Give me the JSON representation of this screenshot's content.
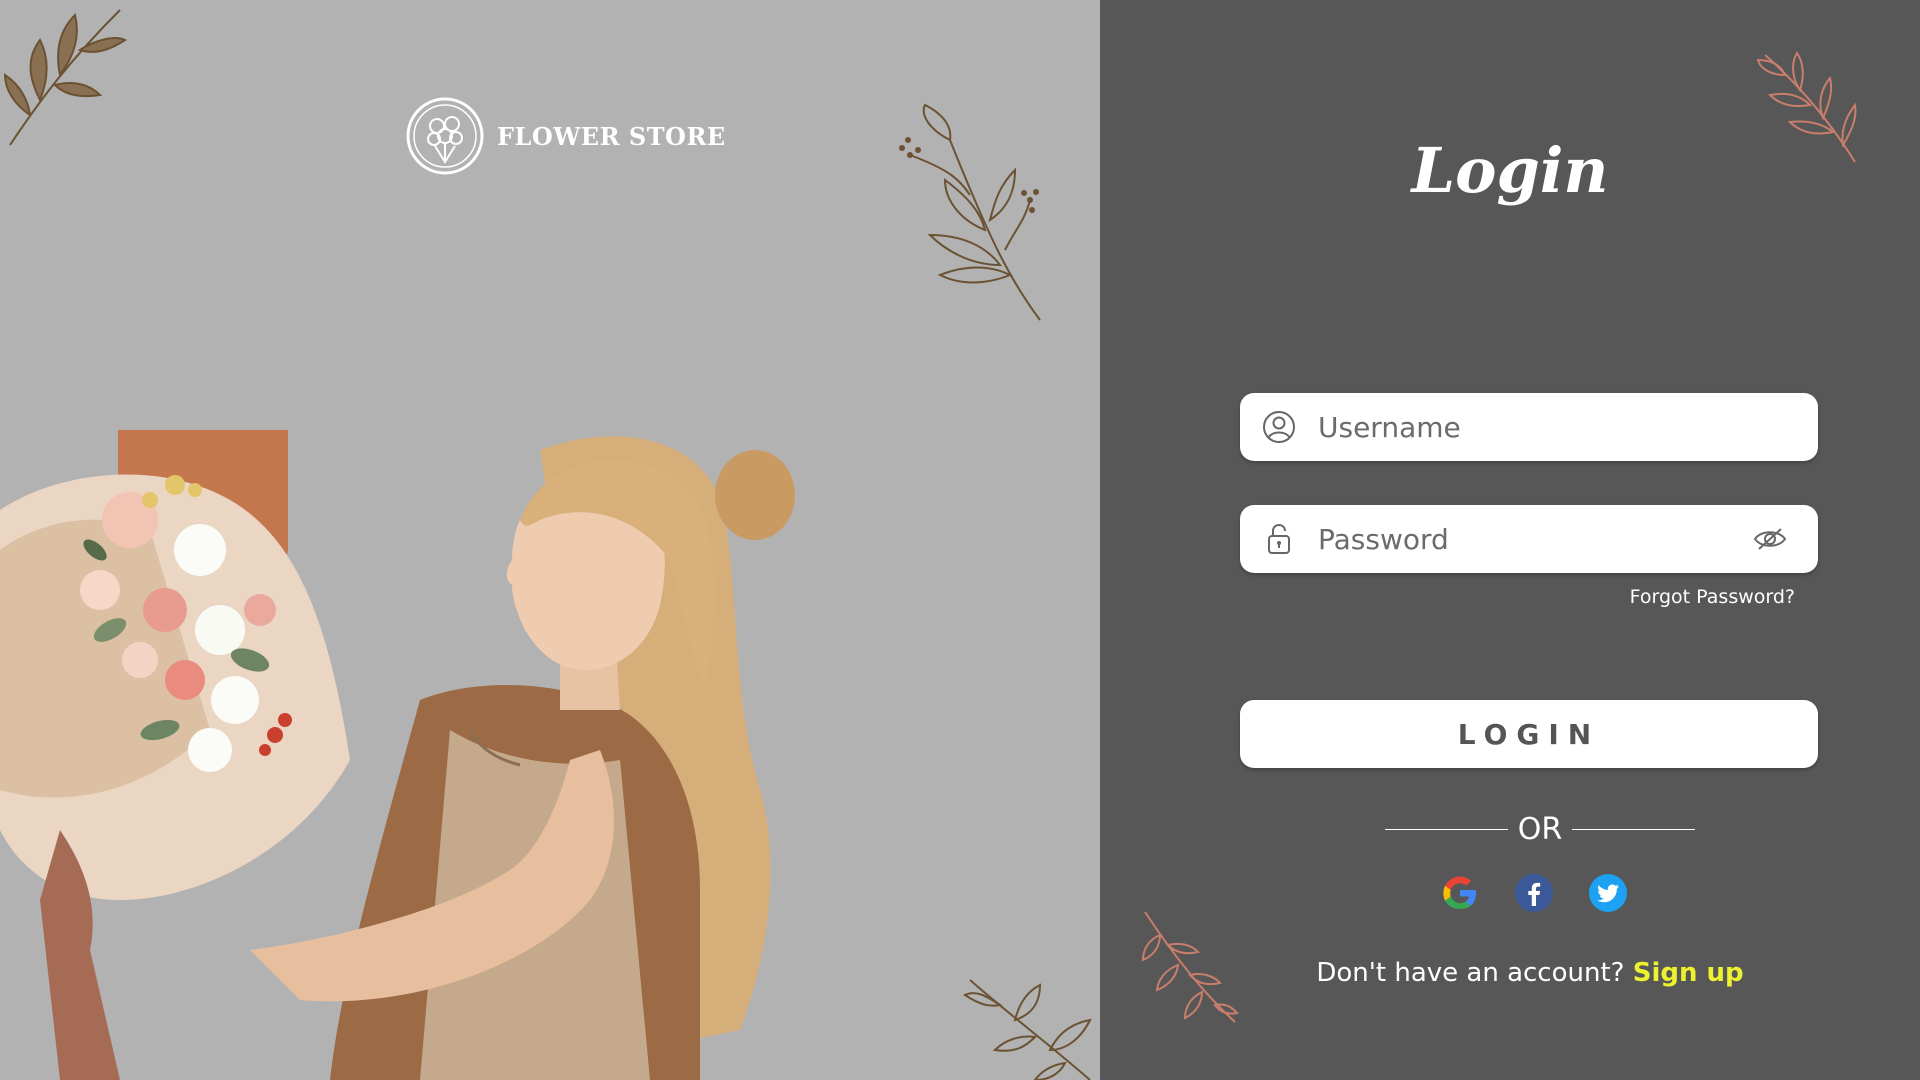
{
  "brand": {
    "name": "FLOWER STORE",
    "logo_icon": "bouquet-icon"
  },
  "login": {
    "title": "Login",
    "username_placeholder": "Username",
    "password_placeholder": "Password",
    "forgot_label": "Forgot Password?",
    "button_label": "LOGIN",
    "or_label": "OR",
    "signup_prompt": "Don't have an account?",
    "signup_label": "Sign up"
  },
  "social": [
    {
      "name": "google-icon"
    },
    {
      "name": "facebook-icon"
    },
    {
      "name": "twitter-icon"
    }
  ],
  "colors": {
    "left_bg": "#b2b2b2",
    "right_bg": "#575757",
    "accent": "#ecf22e",
    "sprig_brown": "#6b5233",
    "sprig_pink": "#c97e6c"
  }
}
